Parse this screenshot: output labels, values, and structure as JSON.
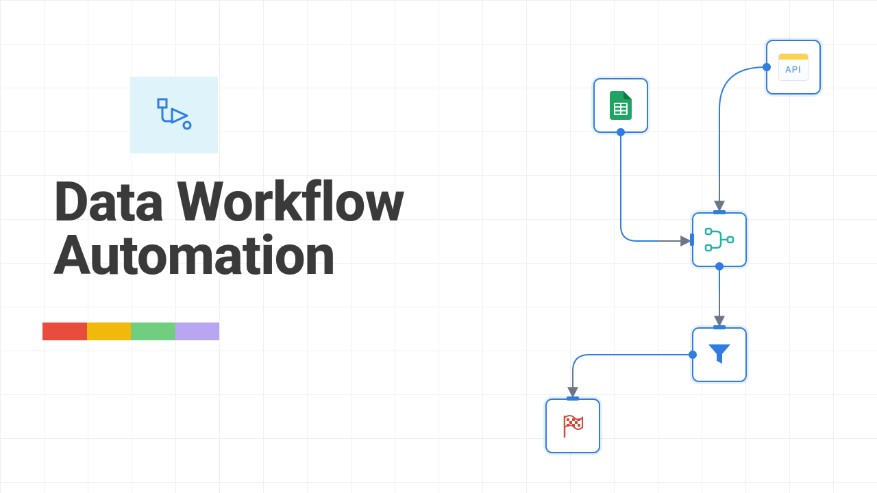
{
  "title": "Data Workflow\nAutomation",
  "hero_icon": "workflow-play-icon",
  "color_bar": [
    "#e74c3c",
    "#f1b90c",
    "#6fcf7f",
    "#b9a6f0"
  ],
  "nodes": {
    "sheets": {
      "name": "google-sheets-node",
      "icon": "sheets-icon"
    },
    "api": {
      "name": "api-node",
      "label": "API",
      "icon": "api-icon"
    },
    "merge": {
      "name": "merge-node",
      "icon": "merge-icon"
    },
    "filter": {
      "name": "filter-node",
      "icon": "filter-icon"
    },
    "finish": {
      "name": "finish-node",
      "icon": "flag-icon"
    }
  },
  "edges": [
    {
      "from": "api",
      "to": "merge"
    },
    {
      "from": "sheets",
      "to": "merge"
    },
    {
      "from": "merge",
      "to": "filter"
    },
    {
      "from": "filter",
      "to": "finish"
    }
  ],
  "accent_color": "#2f7de1"
}
